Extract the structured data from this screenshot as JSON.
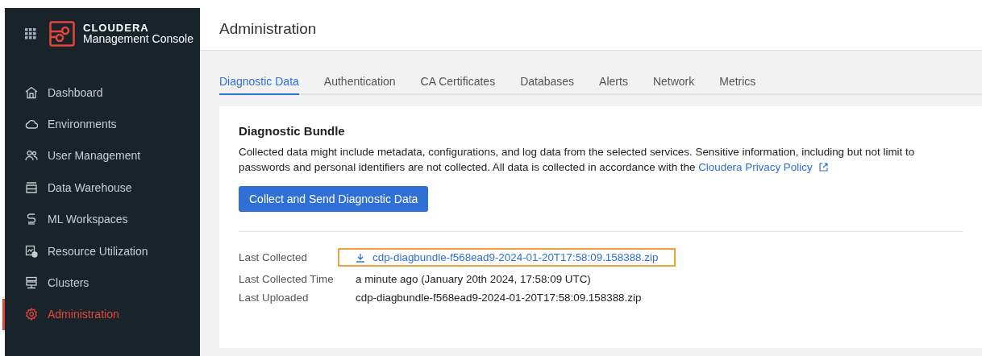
{
  "brand": {
    "name": "CLOUDERA",
    "product": "Management Console"
  },
  "sidebar": {
    "items": [
      {
        "label": "Dashboard",
        "selected": false
      },
      {
        "label": "Environments",
        "selected": false
      },
      {
        "label": "User Management",
        "selected": false
      },
      {
        "label": "Data Warehouse",
        "selected": false
      },
      {
        "label": "ML Workspaces",
        "selected": false
      },
      {
        "label": "Resource Utilization",
        "selected": false
      },
      {
        "label": "Clusters",
        "selected": false
      },
      {
        "label": "Administration",
        "selected": true
      }
    ]
  },
  "page": {
    "title": "Administration"
  },
  "tabs": [
    {
      "label": "Diagnostic Data",
      "selected": true
    },
    {
      "label": "Authentication",
      "selected": false
    },
    {
      "label": "CA Certificates",
      "selected": false
    },
    {
      "label": "Databases",
      "selected": false
    },
    {
      "label": "Alerts",
      "selected": false
    },
    {
      "label": "Network",
      "selected": false
    },
    {
      "label": "Metrics",
      "selected": false
    }
  ],
  "bundle": {
    "title": "Diagnostic Bundle",
    "description": "Collected data might include metadata, configurations, and log data from the selected services. Sensitive information, including but not limit to passwords and personal identifiers are not collected. All data is collected in accordance with the",
    "policy_link": "Cloudera Privacy Policy",
    "button": "Collect and Send Diagnostic Data",
    "details": [
      {
        "label": "Last Collected",
        "value": "cdp-diagbundle-f568ead9-2024-01-20T17:58:09.158388.zip",
        "kind": "download",
        "highlighted": true
      },
      {
        "label": "Last Collected Time",
        "value": "a minute ago (January 20th 2024, 17:58:09 UTC)",
        "kind": "text",
        "highlighted": false
      },
      {
        "label": "Last Uploaded",
        "value": "cdp-diagbundle-f568ead9-2024-01-20T17:58:09.158388.zip",
        "kind": "text",
        "highlighted": false
      }
    ]
  }
}
